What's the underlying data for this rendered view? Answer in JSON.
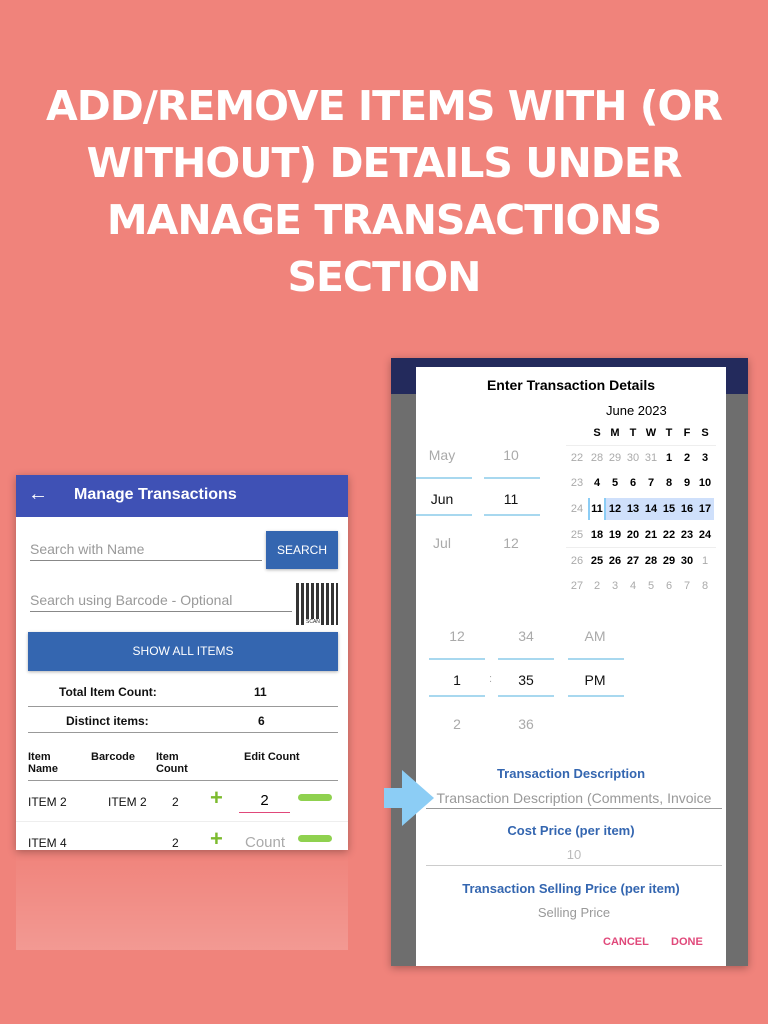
{
  "headline": "ADD/REMOVE ITEMS WITH (OR WITHOUT) DETAILS UNDER MANAGE TRANSACTIONS SECTION",
  "left": {
    "title": "Manage Transactions",
    "search_placeholder": "Search with Name",
    "search_button": "SEARCH",
    "barcode_placeholder": "Search using Barcode - Optional",
    "scan_label": "SCAN",
    "show_all": "SHOW ALL ITEMS",
    "total_label": "Total Item Count:",
    "total_value": "11",
    "distinct_label": "Distinct items:",
    "distinct_value": "6",
    "headers": [
      "Item Name",
      "Barcode",
      "Item Count",
      "Edit Count"
    ],
    "rows": [
      {
        "name": "ITEM 2",
        "barcode": "ITEM 2",
        "count": "2",
        "edit": "2",
        "placeholder": ""
      },
      {
        "name": "ITEM 4",
        "barcode": "",
        "count": "2",
        "edit": "",
        "placeholder": "Count"
      }
    ]
  },
  "dialog": {
    "title": "Enter Transaction Details",
    "month_spinner": [
      "May",
      "Jun",
      "Jul"
    ],
    "day_spinner": [
      "10",
      "11",
      "12"
    ],
    "calendar_title": "June 2023",
    "weekdays": [
      "S",
      "M",
      "T",
      "W",
      "T",
      "F",
      "S"
    ],
    "weeks": [
      {
        "wk": "22",
        "days": [
          "28",
          "29",
          "30",
          "31",
          "1",
          "2",
          "3"
        ]
      },
      {
        "wk": "23",
        "days": [
          "4",
          "5",
          "6",
          "7",
          "8",
          "9",
          "10"
        ]
      },
      {
        "wk": "24",
        "days": [
          "11",
          "12",
          "13",
          "14",
          "15",
          "16",
          "17"
        ]
      },
      {
        "wk": "25",
        "days": [
          "18",
          "19",
          "20",
          "21",
          "22",
          "23",
          "24"
        ]
      },
      {
        "wk": "26",
        "days": [
          "25",
          "26",
          "27",
          "28",
          "29",
          "30",
          "1"
        ]
      },
      {
        "wk": "27",
        "days": [
          "2",
          "3",
          "4",
          "5",
          "6",
          "7",
          "8"
        ]
      }
    ],
    "hour_spinner": [
      "12",
      "1",
      "2"
    ],
    "minute_spinner": [
      "34",
      "35",
      "36"
    ],
    "ampm_spinner": [
      "AM",
      "PM"
    ],
    "time_separator": ":",
    "desc_label": "Transaction Description",
    "desc_placeholder": "Transaction Description (Comments, Invoice",
    "cost_label": "Cost Price (per item)",
    "cost_value": "10",
    "sell_label": "Transaction Selling Price (per item)",
    "sell_placeholder": "Selling Price",
    "cancel": "CANCEL",
    "done": "DONE"
  },
  "colors": {
    "background": "#f0837b",
    "appbar": "#3f51b5",
    "button": "#3466b0",
    "accent": "#e0487a",
    "arrow": "#8ccdf5",
    "highlight": "#cfe0fb"
  }
}
